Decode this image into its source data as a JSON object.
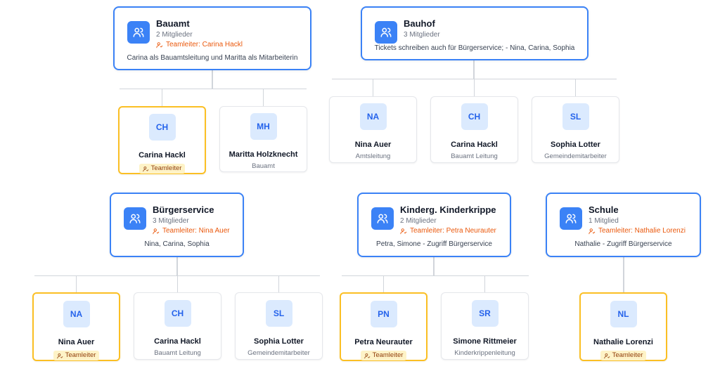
{
  "teams": [
    {
      "name": "Bauamt",
      "count": "2 Mitglieder",
      "lead": "Teamleiter: Carina Hackl",
      "desc": "Carina als Bauamtsleitung und Maritta als Mitarbeiterin"
    },
    {
      "name": "Bauhof",
      "count": "3 Mitglieder",
      "lead": "",
      "desc": "Tickets schreiben auch für Bürgerservice; - Nina, Carina, Sophia"
    },
    {
      "name": "Bürgerservice",
      "count": "3 Mitglieder",
      "lead": "Teamleiter: Nina Auer",
      "desc": "Nina, Carina, Sophia"
    },
    {
      "name": "Kinderg. Kinderkrippe",
      "count": "2 Mitglieder",
      "lead": "Teamleiter: Petra Neurauter",
      "desc": "Petra, Simone - Zugriff Bürgerservice"
    },
    {
      "name": "Schule",
      "count": "1 Mitglied",
      "lead": "Teamleiter: Nathalie Lorenzi",
      "desc": "Nathalie - Zugriff Bürgerservice"
    }
  ],
  "members": [
    {
      "initials": "CH",
      "name": "Carina Hackl",
      "role": "",
      "badge": "Teamleiter"
    },
    {
      "initials": "MH",
      "name": "Maritta Holzknecht",
      "role": "Bauamt",
      "badge": ""
    },
    {
      "initials": "NA",
      "name": "Nina Auer",
      "role": "Amtsleitung",
      "badge": ""
    },
    {
      "initials": "CH",
      "name": "Carina Hackl",
      "role": "Bauamt Leitung",
      "badge": ""
    },
    {
      "initials": "SL",
      "name": "Sophia Lotter",
      "role": "Gemeindemitarbeiter",
      "badge": ""
    },
    {
      "initials": "NA",
      "name": "Nina Auer",
      "role": "",
      "badge": "Teamleiter"
    },
    {
      "initials": "CH",
      "name": "Carina Hackl",
      "role": "Bauamt Leitung",
      "badge": ""
    },
    {
      "initials": "SL",
      "name": "Sophia Lotter",
      "role": "Gemeindemitarbeiter",
      "badge": ""
    },
    {
      "initials": "PN",
      "name": "Petra Neurauter",
      "role": "",
      "badge": "Teamleiter"
    },
    {
      "initials": "SR",
      "name": "Simone Rittmeier",
      "role": "Kinderkrippenleitung",
      "badge": ""
    },
    {
      "initials": "NL",
      "name": "Nathalie Lorenzi",
      "role": "",
      "badge": "Teamleiter"
    }
  ],
  "colors": {
    "accent": "#3b82f6",
    "leader_border": "#fbbf24",
    "lead_text": "#ea580c"
  },
  "icons": {
    "team": "users-icon",
    "lead": "user-check-icon"
  }
}
